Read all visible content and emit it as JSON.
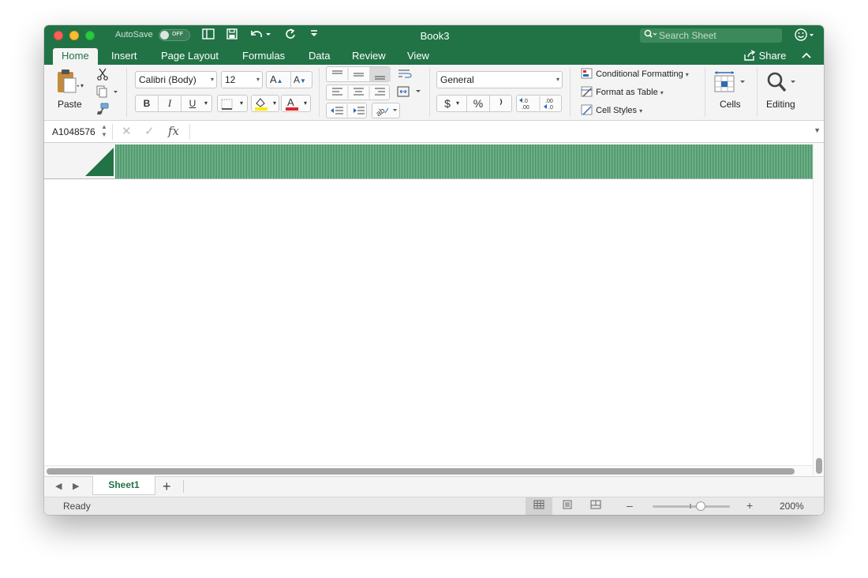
{
  "titlebar": {
    "autosave_label": "AutoSave",
    "autosave_state": "OFF",
    "doc_title": "Book3",
    "search_placeholder": "Search Sheet"
  },
  "tabs": [
    {
      "label": "Home",
      "active": true
    },
    {
      "label": "Insert"
    },
    {
      "label": "Page Layout"
    },
    {
      "label": "Formulas"
    },
    {
      "label": "Data"
    },
    {
      "label": "Review"
    },
    {
      "label": "View"
    }
  ],
  "share_label": "Share",
  "ribbon": {
    "paste_label": "Paste",
    "font_name": "Calibri (Body)",
    "font_size": "12",
    "number_format": "General",
    "conditional_formatting": "Conditional Formatting",
    "format_as_table": "Format as Table",
    "cell_styles": "Cell Styles",
    "cells_label": "Cells",
    "editing_label": "Editing",
    "bold": "B",
    "italic": "I",
    "underline": "U",
    "currency": "$",
    "percent": "%",
    "comma": "⁾",
    "inc_decimal": "←.0 .00",
    "dec_decimal": ".00 →.0"
  },
  "formula_bar": {
    "name_box": "A1048576",
    "fx": "fx",
    "value": ""
  },
  "sheet_tabs": [
    {
      "label": "Sheet1",
      "active": true
    }
  ],
  "status": {
    "ready": "Ready",
    "zoom": "200%"
  },
  "colors": {
    "excel_green": "#217346",
    "ribbon_bg": "#f4f4f4",
    "fill_yellow": "#ffe800",
    "font_red": "#e0252b"
  },
  "icons": [
    "search-icon",
    "smiley-icon",
    "cut-icon",
    "copy-icon",
    "format-painter-icon",
    "share-icon",
    "chevron-up-icon",
    "fx-icon"
  ]
}
